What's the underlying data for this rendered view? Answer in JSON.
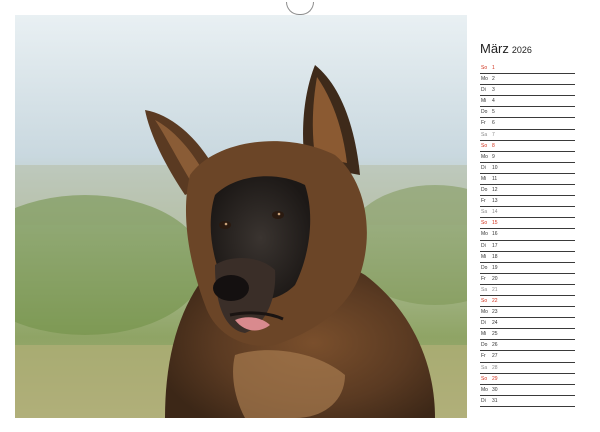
{
  "calendar": {
    "month": "März",
    "year": "2026",
    "days": [
      {
        "wd": "So",
        "d": "1",
        "t": "sun"
      },
      {
        "wd": "Mo",
        "d": "2",
        "t": "wk"
      },
      {
        "wd": "Di",
        "d": "3",
        "t": "wk"
      },
      {
        "wd": "Mi",
        "d": "4",
        "t": "wk"
      },
      {
        "wd": "Do",
        "d": "5",
        "t": "wk"
      },
      {
        "wd": "Fr",
        "d": "6",
        "t": "wk"
      },
      {
        "wd": "Sa",
        "d": "7",
        "t": "sat"
      },
      {
        "wd": "So",
        "d": "8",
        "t": "sun"
      },
      {
        "wd": "Mo",
        "d": "9",
        "t": "wk"
      },
      {
        "wd": "Di",
        "d": "10",
        "t": "wk"
      },
      {
        "wd": "Mi",
        "d": "11",
        "t": "wk"
      },
      {
        "wd": "Do",
        "d": "12",
        "t": "wk"
      },
      {
        "wd": "Fr",
        "d": "13",
        "t": "wk"
      },
      {
        "wd": "Sa",
        "d": "14",
        "t": "sat"
      },
      {
        "wd": "So",
        "d": "15",
        "t": "sun"
      },
      {
        "wd": "Mo",
        "d": "16",
        "t": "wk"
      },
      {
        "wd": "Di",
        "d": "17",
        "t": "wk"
      },
      {
        "wd": "Mi",
        "d": "18",
        "t": "wk"
      },
      {
        "wd": "Do",
        "d": "19",
        "t": "wk"
      },
      {
        "wd": "Fr",
        "d": "20",
        "t": "wk"
      },
      {
        "wd": "Sa",
        "d": "21",
        "t": "sat"
      },
      {
        "wd": "So",
        "d": "22",
        "t": "sun"
      },
      {
        "wd": "Mo",
        "d": "23",
        "t": "wk"
      },
      {
        "wd": "Di",
        "d": "24",
        "t": "wk"
      },
      {
        "wd": "Mi",
        "d": "25",
        "t": "wk"
      },
      {
        "wd": "Do",
        "d": "26",
        "t": "wk"
      },
      {
        "wd": "Fr",
        "d": "27",
        "t": "wk"
      },
      {
        "wd": "Sa",
        "d": "28",
        "t": "sat"
      },
      {
        "wd": "So",
        "d": "29",
        "t": "sun"
      },
      {
        "wd": "Mo",
        "d": "30",
        "t": "wk"
      },
      {
        "wd": "Di",
        "d": "31",
        "t": "wk"
      }
    ]
  },
  "colors": {
    "sunday": "#d0311c",
    "saturday": "#8a8a8a",
    "text": "#333333"
  }
}
